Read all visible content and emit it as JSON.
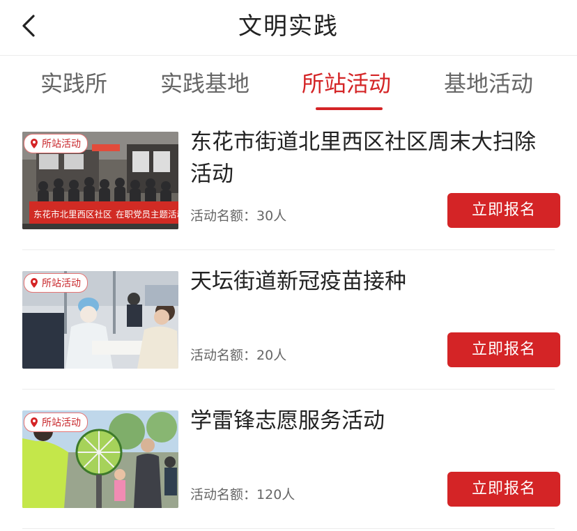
{
  "header": {
    "title": "文明实践",
    "back_icon": "back-arrow-icon"
  },
  "tabs": [
    {
      "label": "实践所",
      "active": false
    },
    {
      "label": "实践基地",
      "active": false
    },
    {
      "label": "所站活动",
      "active": true
    },
    {
      "label": "基地活动",
      "active": false
    }
  ],
  "colors": {
    "accent": "#d42426",
    "text": "#222222",
    "muted": "#666666"
  },
  "activities": [
    {
      "badge": "所站活动",
      "title": "东花市街道北里西区社区周末大扫除活动",
      "quota_label": "活动名额：",
      "quota": "30人",
      "button": "立即报名",
      "banner_left": "东花市北里西区社区",
      "banner_right": "在职党员主题活动"
    },
    {
      "badge": "所站活动",
      "title": "天坛街道新冠疫苗接种",
      "quota_label": "活动名额：",
      "quota": "20人",
      "button": "立即报名"
    },
    {
      "badge": "所站活动",
      "title": "学雷锋志愿服务活动",
      "quota_label": "活动名额：",
      "quota": "120人",
      "button": "立即报名"
    }
  ]
}
